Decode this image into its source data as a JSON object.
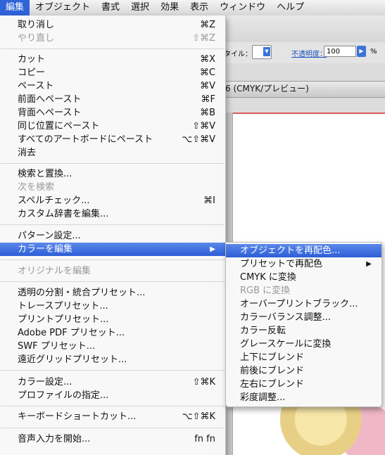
{
  "menubar": {
    "items": [
      "編集",
      "オブジェクト",
      "書式",
      "選択",
      "効果",
      "表示",
      "ウィンドウ",
      "ヘルプ"
    ]
  },
  "background": {
    "style_label": "タイル：",
    "opacity_label": "不透明度：",
    "opacity_value": "100",
    "opacity_unit": "%",
    "doc_tab": "6 (CMYK/プレビュー)"
  },
  "edit_menu": {
    "items": [
      {
        "label": "取り消し",
        "shortcut": "⌘Z",
        "disabled": false
      },
      {
        "label": "やり直し",
        "shortcut": "⇧⌘Z",
        "disabled": true
      },
      {
        "label": "カット",
        "shortcut": "⌘X",
        "disabled": false
      },
      {
        "label": "コピー",
        "shortcut": "⌘C",
        "disabled": false
      },
      {
        "label": "ペースト",
        "shortcut": "⌘V",
        "disabled": false
      },
      {
        "label": "前面へペースト",
        "shortcut": "⌘F",
        "disabled": false
      },
      {
        "label": "背面へペースト",
        "shortcut": "⌘B",
        "disabled": false
      },
      {
        "label": "同じ位置にペースト",
        "shortcut": "⇧⌘V",
        "disabled": false
      },
      {
        "label": "すべてのアートボードにペースト",
        "shortcut": "⌥⇧⌘V",
        "disabled": false
      },
      {
        "label": "消去",
        "shortcut": "",
        "disabled": false
      },
      {
        "label": "検索と置換...",
        "shortcut": "",
        "disabled": false
      },
      {
        "label": "次を検索",
        "shortcut": "",
        "disabled": true
      },
      {
        "label": "スペルチェック...",
        "shortcut": "⌘I",
        "disabled": false
      },
      {
        "label": "カスタム辞書を編集...",
        "shortcut": "",
        "disabled": false
      },
      {
        "label": "パターン設定...",
        "shortcut": "",
        "disabled": false
      },
      {
        "label": "カラーを編集",
        "shortcut": "▶",
        "disabled": false,
        "highlighted": true
      },
      {
        "label": "オリジナルを編集",
        "shortcut": "",
        "disabled": true
      },
      {
        "label": "透明の分割・統合プリセット...",
        "shortcut": "",
        "disabled": false
      },
      {
        "label": "トレースプリセット...",
        "shortcut": "",
        "disabled": false
      },
      {
        "label": "プリントプリセット...",
        "shortcut": "",
        "disabled": false
      },
      {
        "label": "Adobe PDF プリセット...",
        "shortcut": "",
        "disabled": false
      },
      {
        "label": "SWF プリセット...",
        "shortcut": "",
        "disabled": false
      },
      {
        "label": "遠近グリッドプリセット...",
        "shortcut": "",
        "disabled": false
      },
      {
        "label": "カラー設定...",
        "shortcut": "⇧⌘K",
        "disabled": false
      },
      {
        "label": "プロファイルの指定...",
        "shortcut": "",
        "disabled": false
      },
      {
        "label": "キーボードショートカット...",
        "shortcut": "⌥⇧⌘K",
        "disabled": false
      },
      {
        "label": "音声入力を開始...",
        "shortcut": "fn fn",
        "disabled": false
      }
    ]
  },
  "color_submenu": {
    "items": [
      {
        "label": "オブジェクトを再配色...",
        "disabled": false,
        "highlighted": true
      },
      {
        "label": "プリセットで再配色",
        "disabled": false,
        "arrow": "▶"
      },
      {
        "label": "CMYK に変換",
        "disabled": false
      },
      {
        "label": "RGB に変換",
        "disabled": true
      },
      {
        "label": "オーバープリントブラック...",
        "disabled": false
      },
      {
        "label": "カラーバランス調整...",
        "disabled": false
      },
      {
        "label": "カラー反転",
        "disabled": false
      },
      {
        "label": "グレースケールに変換",
        "disabled": false
      },
      {
        "label": "上下にブレンド",
        "disabled": false
      },
      {
        "label": "前後にブレンド",
        "disabled": false
      },
      {
        "label": "左右にブレンド",
        "disabled": false
      },
      {
        "label": "彩度調整...",
        "disabled": false
      }
    ]
  },
  "colors": {
    "highlight": "#2d5fd6",
    "disabled_text": "#9a9a9a"
  }
}
